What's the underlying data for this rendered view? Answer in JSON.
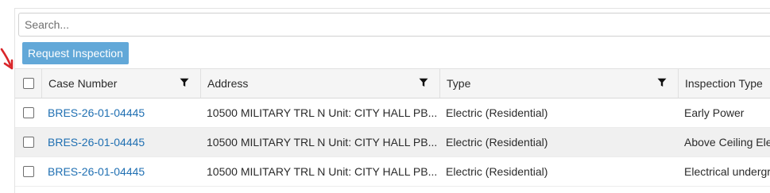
{
  "search": {
    "placeholder": "Search..."
  },
  "toolbar": {
    "request_label": "Request Inspection"
  },
  "colors": {
    "accent": "#62a8d8",
    "link": "#1f6fb2",
    "annotation_arrow": "#d9262a"
  },
  "icons": {
    "filter": "filter-icon",
    "pointer": "red-arrow-icon"
  },
  "table": {
    "headers": {
      "case_number": "Case Number",
      "address": "Address",
      "type": "Type",
      "inspection_type": "Inspection Type"
    },
    "rows": [
      {
        "case_number": "BRES-26-01-04445",
        "address": "10500 MILITARY TRL N Unit: CITY HALL PB...",
        "type": "Electric (Residential)",
        "inspection_type": "Early Power"
      },
      {
        "case_number": "BRES-26-01-04445",
        "address": "10500 MILITARY TRL N Unit: CITY HALL PB...",
        "type": "Electric (Residential)",
        "inspection_type": "Above Ceiling Ele"
      },
      {
        "case_number": "BRES-26-01-04445",
        "address": "10500 MILITARY TRL N Unit: CITY HALL PB...",
        "type": "Electric (Residential)",
        "inspection_type": "Electrical undergr"
      }
    ]
  }
}
